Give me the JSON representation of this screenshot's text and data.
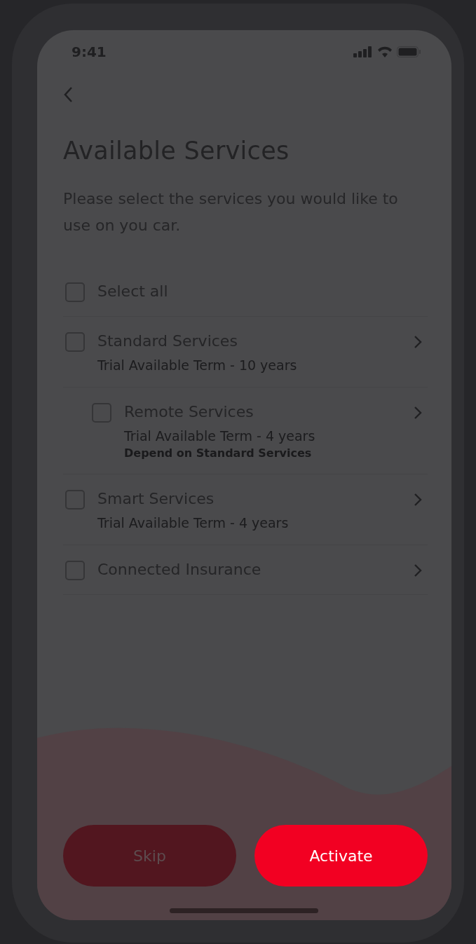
{
  "status_bar": {
    "time": "9:41"
  },
  "title": "Available Services",
  "description": "Please select the services you would like to use on you car.",
  "select_all": {
    "label": "Select all",
    "checked": false
  },
  "services": [
    {
      "name": "Standard Services",
      "checked": false,
      "term": "Trial Available Term - 10 years",
      "children": [
        {
          "name": "Remote Services",
          "checked": false,
          "term": "Trial Available Term - 4 years",
          "note": "Depend on Standard Services"
        }
      ]
    },
    {
      "name": "Smart Services",
      "checked": false,
      "term": "Trial Available Term - 4 years"
    },
    {
      "name": "Connected Insurance",
      "checked": false
    }
  ],
  "buttons": [
    {
      "label": "Skip",
      "kind": "secondary"
    },
    {
      "label": "Activate",
      "kind": "primary"
    }
  ]
}
